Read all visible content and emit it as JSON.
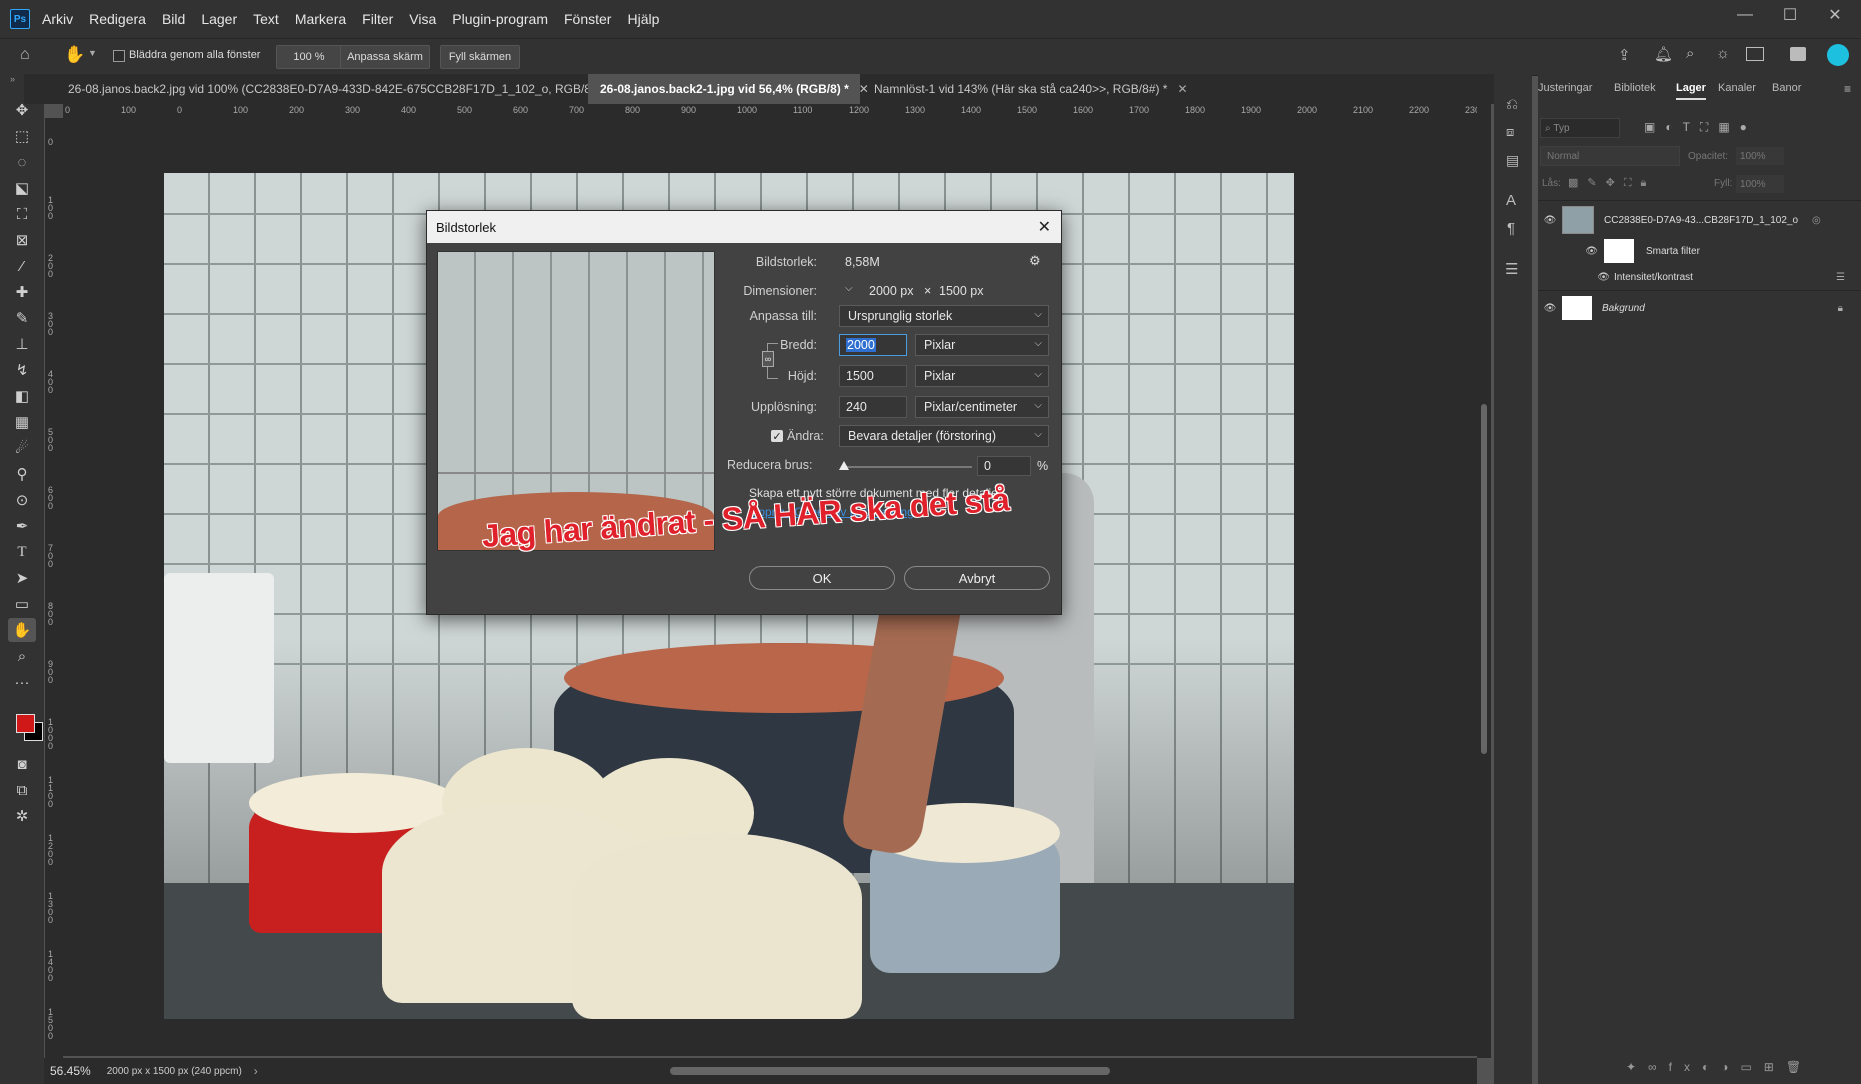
{
  "menubar": {
    "logo": "Ps",
    "items": [
      "Arkiv",
      "Redigera",
      "Bild",
      "Lager",
      "Text",
      "Markera",
      "Filter",
      "Visa",
      "Plugin-program",
      "Fönster",
      "Hjälp"
    ]
  },
  "window_controls": {
    "minimize": "—",
    "maximize": "☐",
    "close": "✕"
  },
  "options_bar": {
    "scroll_all_label": "Bläddra genom alla fönster",
    "zoom_value": "100 %",
    "fit_screen_label": "Anpassa skärm",
    "fill_screen_label": "Fyll skärmen"
  },
  "tabs": [
    {
      "label": "26-08.janos.back2.jpg vid 100% (CC2838E0-D7A9-433D-842E-675CCB28F17D_1_102_o, RGB/8) *",
      "active": false
    },
    {
      "label": "26-08.janos.back2-1.jpg vid 56,4% (RGB/8) *",
      "active": true
    },
    {
      "label": "Namnlöst-1 vid 143% (Här ska stå ca240>>, RGB/8#) *",
      "active": false
    }
  ],
  "ruler": {
    "h_ticks": [
      "0",
      "100",
      "0",
      "100",
      "200",
      "300",
      "400",
      "500",
      "600",
      "700",
      "800",
      "900",
      "1000",
      "1100",
      "1200",
      "1300",
      "1400",
      "1500",
      "1600",
      "1700",
      "1800",
      "1900",
      "2000",
      "2100",
      "2200",
      "230"
    ],
    "v_ticks": [
      "0",
      "1 0 0",
      "2 0 0",
      "3 0 0",
      "4 0 0",
      "5 0 0",
      "6 0 0",
      "7 0 0",
      "8 0 0",
      "9 0 0",
      "1 0 0 0",
      "1 1 0 0",
      "1 2 0 0",
      "1 3 0 0",
      "1 4 0 0",
      "1 5 0 0"
    ]
  },
  "status": {
    "zoom": "56.45%",
    "doc_info": "2000 px x 1500 px (240 ppcm)"
  },
  "panels": {
    "tabs": [
      "Justeringar",
      "Bibliotek",
      "Lager",
      "Kanaler",
      "Banor"
    ],
    "active_tab": "Lager",
    "search_placeholder": "Typ",
    "blend_mode": "Normal",
    "opacity_label": "Opacitet:",
    "opacity_value": "100%",
    "lock_label": "Lås:",
    "fill_label": "Fyll:",
    "fill_value": "100%",
    "layers": [
      {
        "name": "CC2838E0-D7A9-43...CB28F17D_1_102_o"
      },
      {
        "name": "Smarta filter"
      },
      {
        "name": "Intensitet/kontrast"
      },
      {
        "name": "Bakgrund"
      }
    ]
  },
  "dialog": {
    "title": "Bildstorlek",
    "image_size_label": "Bildstorlek:",
    "image_size_value": "8,58M",
    "dimensions_label": "Dimensioner:",
    "dim_w": "2000 px",
    "dim_x": "×",
    "dim_h": "1500 px",
    "fit_to_label": "Anpassa till:",
    "fit_to_value": "Ursprunglig storlek",
    "width_label": "Bredd:",
    "width_value": "2000",
    "width_unit": "Pixlar",
    "height_label": "Höjd:",
    "height_value": "1500",
    "height_unit": "Pixlar",
    "resolution_label": "Upplösning:",
    "resolution_value": "240",
    "resolution_unit": "Pixlar/centimeter",
    "resample_label": "Ändra:",
    "resample_value": "Bevara detaljer (förstoring)",
    "noise_label": "Reducera brus:",
    "noise_value": "0",
    "noise_unit": "%",
    "noise_level": 0,
    "generative_text": "Skapa ett nytt större dokument med fler detaljer",
    "generative_link": "Öppna i Generativ uppskalning",
    "ok_label": "OK",
    "cancel_label": "Avbryt"
  },
  "annotation": {
    "text": "Jag har ändrat - SÅ HÄR ska det stå",
    "color": "#e0202a"
  },
  "colors": {
    "foreground": "#d01818",
    "background": "#000000",
    "accent": "#31a8ff"
  }
}
